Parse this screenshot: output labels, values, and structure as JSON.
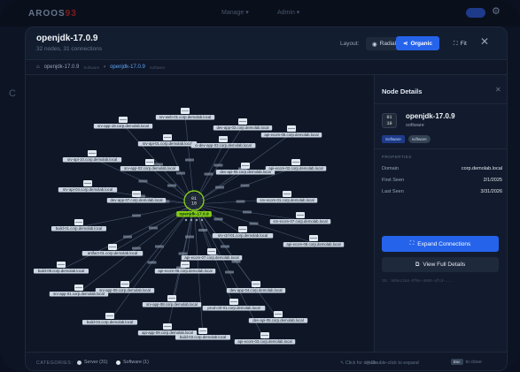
{
  "app": {
    "logo_text": "AROOS",
    "logo_accent": "93",
    "menu1": "Manage ▾",
    "menu2": "Admin ▾"
  },
  "header": {
    "title": "openjdk-17.0.9",
    "subtitle": "32 nodes, 31 connections",
    "layout_label": "Layout:",
    "radial_label": "Radial",
    "organic_label": "Organic",
    "fit_label": "Fit",
    "close_symbol": "✕"
  },
  "breadcrumb": {
    "root_label": "openjdk-17.0.9",
    "root_tag": "Software",
    "sep": "›",
    "current_label": "openjdk-17.0.9",
    "current_tag": "Software"
  },
  "graph": {
    "center": {
      "label": "openjdk-17.0.9",
      "icon_text": "01\n10"
    },
    "nodes": [
      "srv-app-19.corp.demolab.local",
      "srv-web-01.corp.demolab.local",
      "dev-app-02.corp.demolab.local",
      "srv-api-10.corp.demolab.local",
      "srv-api-01.corp.demolab.local",
      "ci-dev-app-03.corp.demolab.local",
      "api-ecom-05.corp.demolab.local",
      "srv-api-04.corp.demolab.local",
      "dev-api-05.corp.demolab.local",
      "srv-app-02.corp.demolab.local",
      "api-ecom-02.corp.demolab.local",
      "build-01.corp.demolab.local",
      "srv-ecom-01.corp.demolab.local",
      "artifact-01.corp.demolab.local",
      "srv-ecom-07.corp.demolab.local",
      "api-ecom-08.corp.demolab.local",
      "build-09.corp.demolab.local",
      "srv-app-06.corp.demolab.local",
      "dev-app-04.corp.demolab.local",
      "srv-app-08.corp.demolab.local",
      "prod-ctrl-01.corp.demolab.local",
      "build-04.corp.demolab.local",
      "dev-api-05.corp.demolab.local",
      "api-app-09.corp.demolab.local",
      "build-03.corp.demolab.local",
      "srv-app-01.corp.demolab.local",
      "api-ecom-03.corp.demolab.local",
      "api-ecom-06.corp.demolab.local",
      "api-ecom-07.corp.demolab.local",
      "dev-app-07.corp.demolab.local",
      "srv-ctrl-01.corp.demolab.local"
    ]
  },
  "panel": {
    "title": "Node Details",
    "close_symbol": "✕",
    "icon_text": "01\n10",
    "name": "openjdk-17.0.9",
    "type": "software",
    "badge_primary": "Software",
    "badge_secondary": "software",
    "properties_heading": "PROPERTIES",
    "properties": [
      {
        "key": "Domain",
        "value": "corp.demolab.local"
      },
      {
        "key": "First Seen",
        "value": "2/1/2025"
      },
      {
        "key": "Last Seen",
        "value": "3/31/2026"
      }
    ],
    "expand_label": "Expand Connections",
    "view_label": "View Full Details",
    "id_text": "ID: 9d5ec2a8-0f6e-4865-afc4-..."
  },
  "footer": {
    "categories_label": "CATEGORIES:",
    "legend": [
      {
        "label": "Server (31)",
        "color": "#cbd5e1"
      },
      {
        "label": "Software (1)",
        "color": "#e2e8f0"
      }
    ],
    "hint_click": "Click for details",
    "hint_dblclick": "Double-click to expand",
    "esc_key": "Esc",
    "esc_text": "to close"
  },
  "colors": {
    "accent": "#2563eb",
    "center_node": "#84cc16",
    "edge": "#64748b"
  }
}
